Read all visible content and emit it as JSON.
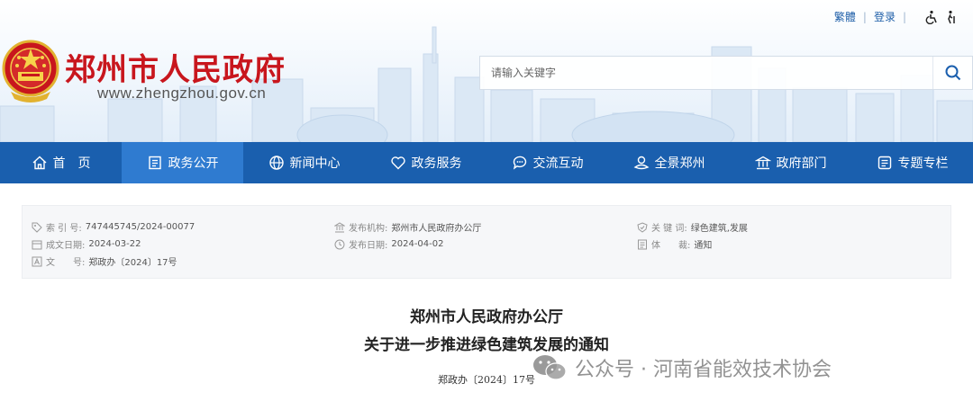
{
  "top_links": {
    "traditional": "繁體",
    "login": "登录"
  },
  "site": {
    "title": "郑州市人民政府",
    "url": "www.zhengzhou.gov.cn"
  },
  "search": {
    "placeholder": "请输入关键字"
  },
  "nav": {
    "items": [
      {
        "label": "首　页",
        "icon": "home-icon"
      },
      {
        "label": "政务公开",
        "icon": "document-icon",
        "active": true
      },
      {
        "label": "新闻中心",
        "icon": "globe-icon"
      },
      {
        "label": "政务服务",
        "icon": "heart-icon"
      },
      {
        "label": "交流互动",
        "icon": "chat-icon"
      },
      {
        "label": "全景郑州",
        "icon": "panorama-icon"
      },
      {
        "label": "政府部门",
        "icon": "building-icon"
      },
      {
        "label": "专题专栏",
        "icon": "list-icon"
      }
    ]
  },
  "meta": {
    "index_label": "索 引 号:",
    "index_value": "747445745/2024-00077",
    "created_label": "成文日期:",
    "created_value": "2024-03-22",
    "docno_label": "文　　号:",
    "docno_value": "郑政办〔2024〕17号",
    "issuer_label": "发布机构:",
    "issuer_value": "郑州市人民政府办公厅",
    "published_label": "发布日期:",
    "published_value": "2024-04-02",
    "keywords_label": "关 键 词:",
    "keywords_value": "绿色建筑,发展",
    "genre_label": "体　　裁:",
    "genre_value": "通知"
  },
  "document": {
    "title_line1": "郑州市人民政府办公厅",
    "title_line2": "关于进一步推进绿色建筑发展的通知",
    "number": "郑政办〔2024〕17号"
  },
  "watermark": {
    "text": "公众号 · 河南省能效技术协会"
  },
  "colors": {
    "nav_bg": "#1a5fae",
    "nav_active": "#2f7bd0",
    "title_red": "#c8161d"
  }
}
